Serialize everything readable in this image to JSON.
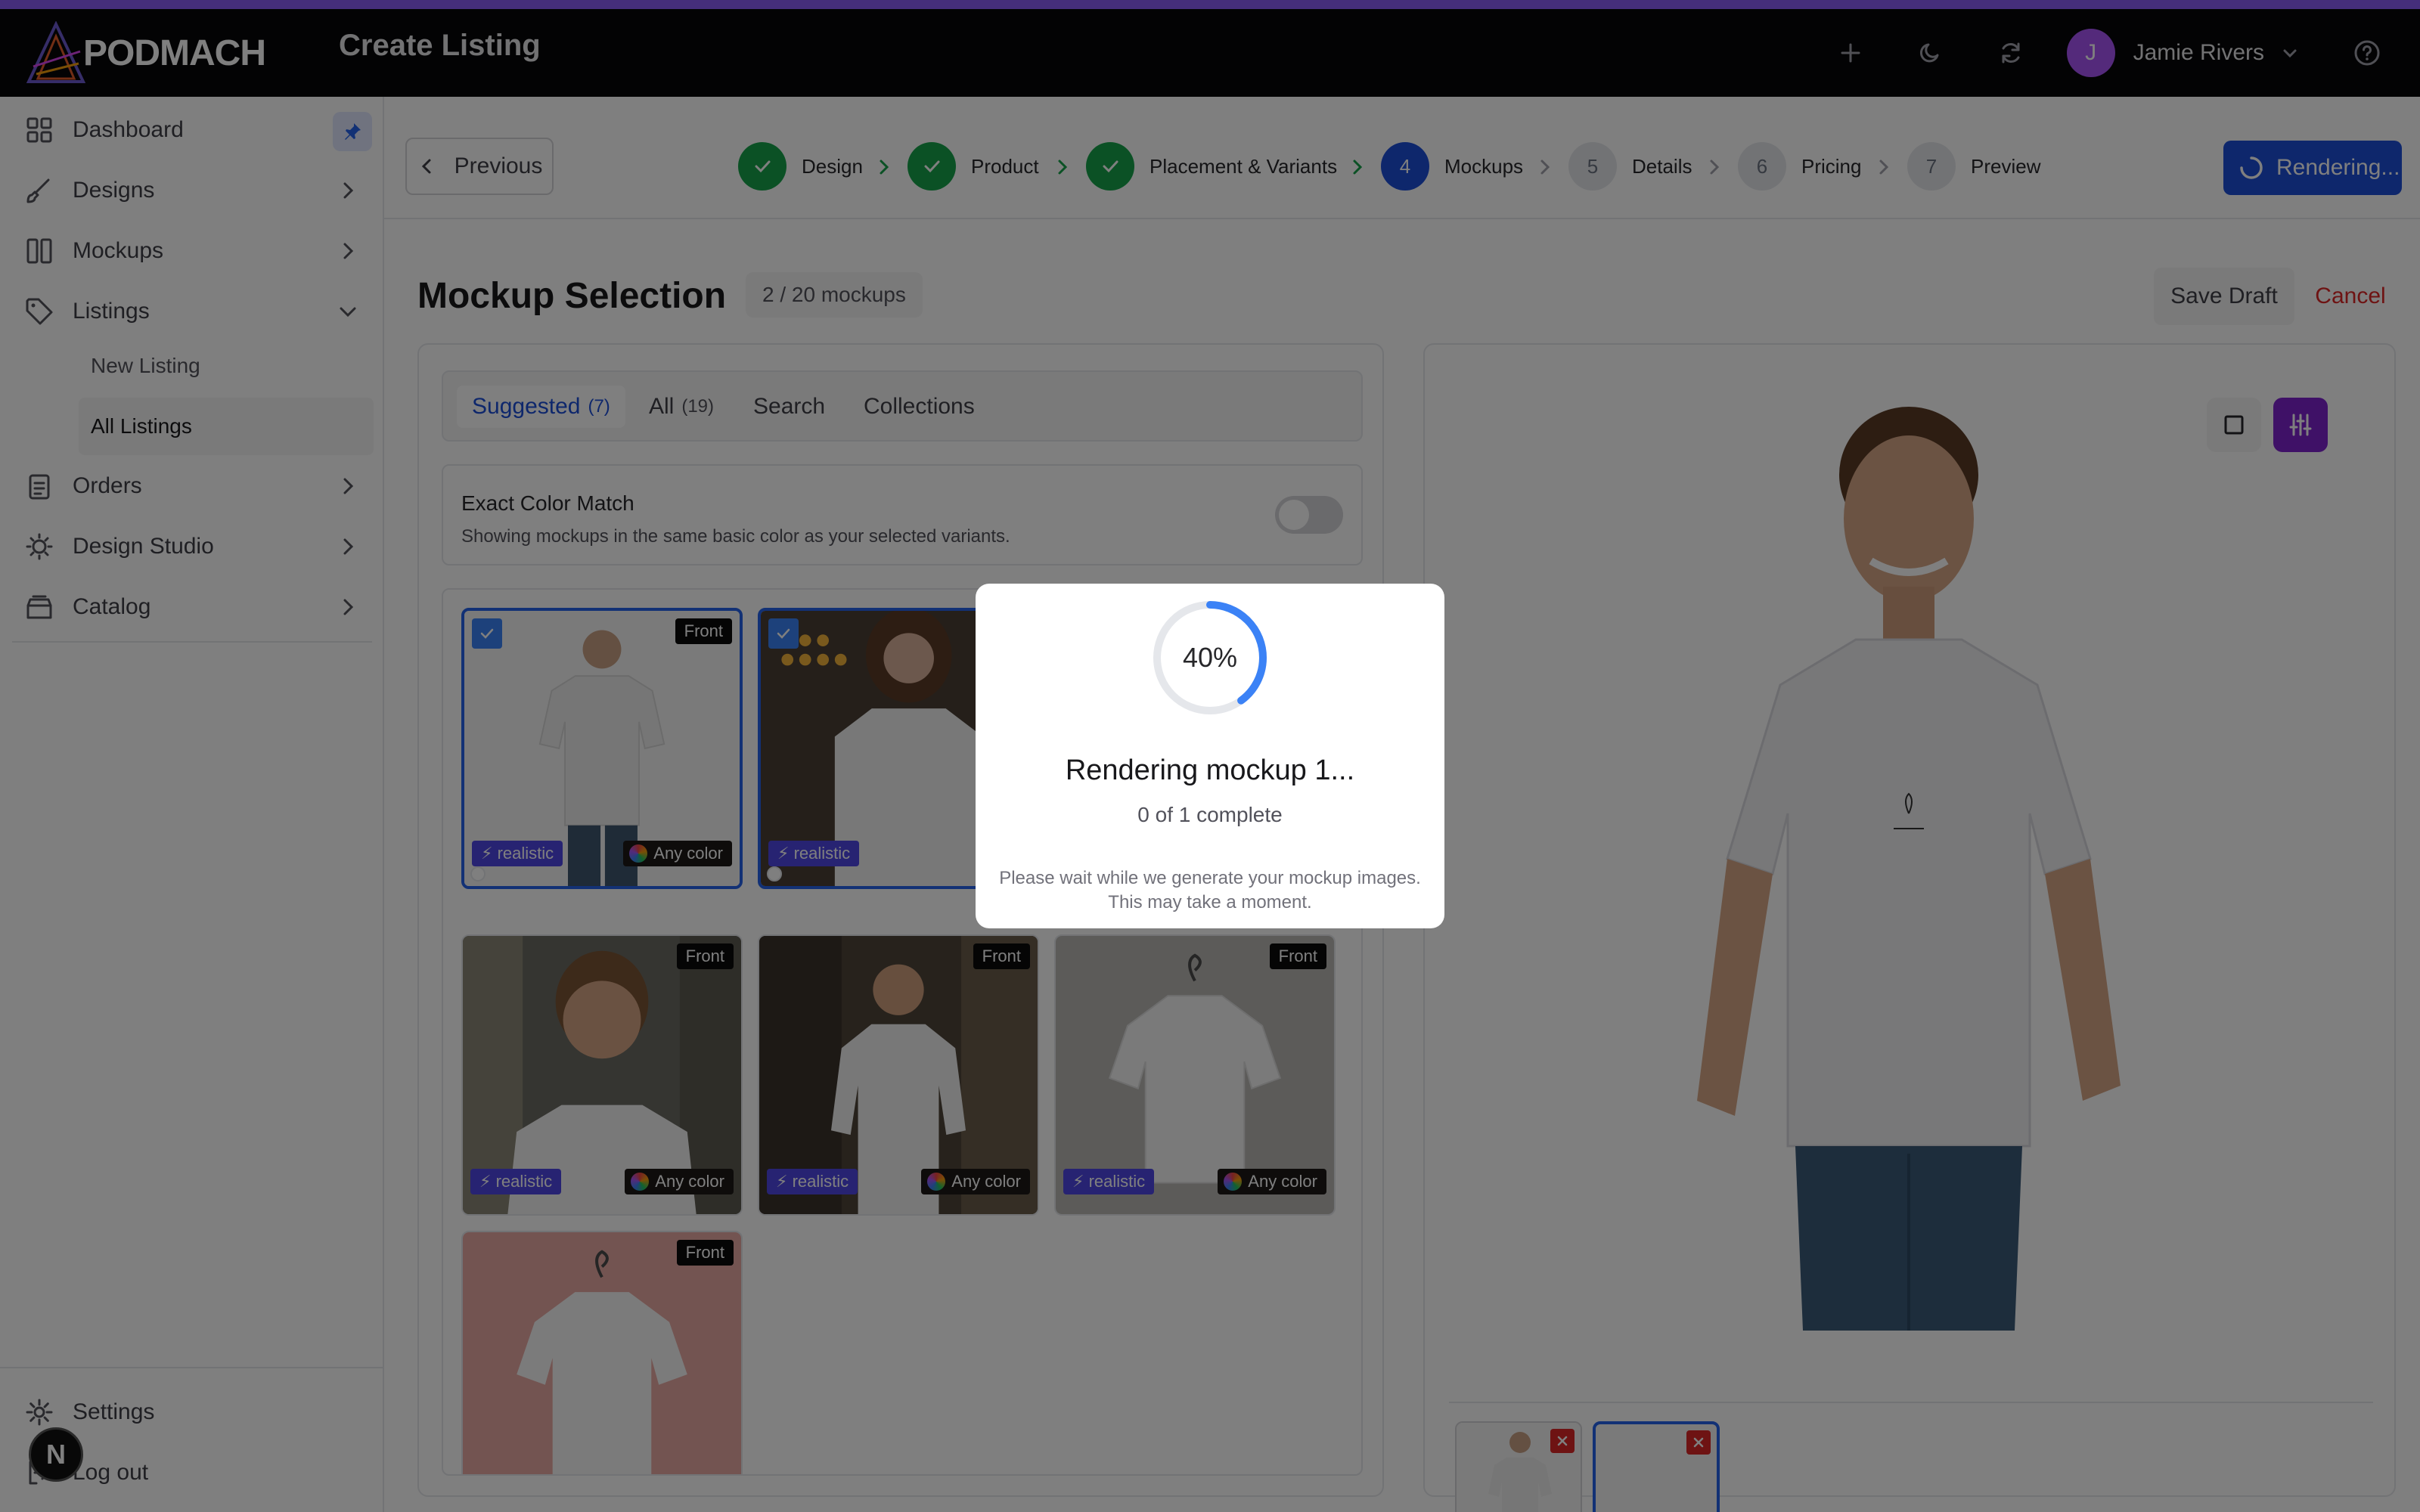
{
  "app": {
    "brand": "PODMACH",
    "page_title": "Create Listing",
    "user_name": "Jamie Rivers",
    "user_initial": "J",
    "accent_color": "#8b5cf6"
  },
  "sidebar": {
    "items": [
      {
        "label": "Dashboard",
        "icon": "grid-icon"
      },
      {
        "label": "Designs",
        "icon": "brush-icon"
      },
      {
        "label": "Mockups",
        "icon": "columns-icon"
      },
      {
        "label": "Listings",
        "icon": "tag-icon"
      },
      {
        "label": "Orders",
        "icon": "clipboard-icon"
      },
      {
        "label": "Design Studio",
        "icon": "lightbulb-icon"
      },
      {
        "label": "Catalog",
        "icon": "archive-icon"
      }
    ],
    "sub_items": [
      "New Listing",
      "All Listings"
    ],
    "settings_label": "Settings",
    "logout_label": "Log out",
    "badge_letter": "N"
  },
  "stepper": {
    "previous_label": "Previous",
    "steps": [
      {
        "num": "1",
        "label": "Design",
        "state": "done"
      },
      {
        "num": "2",
        "label": "Product",
        "state": "done"
      },
      {
        "num": "3",
        "label": "Placement & Variants",
        "state": "done"
      },
      {
        "num": "4",
        "label": "Mockups",
        "state": "current"
      },
      {
        "num": "5",
        "label": "Details",
        "state": "todo"
      },
      {
        "num": "6",
        "label": "Pricing",
        "state": "todo"
      },
      {
        "num": "7",
        "label": "Preview",
        "state": "todo"
      }
    ],
    "render_label": "Rendering..."
  },
  "selection": {
    "title": "Mockup Selection",
    "count": "2 / 20 mockups",
    "save_draft": "Save Draft",
    "cancel": "Cancel"
  },
  "tabs": [
    {
      "label": "Suggested",
      "count": "(7)"
    },
    {
      "label": "All",
      "count": "(19)"
    },
    {
      "label": "Search",
      "count": ""
    },
    {
      "label": "Collections",
      "count": ""
    }
  ],
  "color_match": {
    "title": "Exact Color Match",
    "description": "Showing mockups in the same basic color as your selected variants."
  },
  "card_tags": {
    "front": "Front",
    "realistic": "realistic",
    "any_color": "Any color",
    "any_color_partial": "An"
  },
  "modal": {
    "progress": 0.4,
    "percent_label": "40%",
    "title": "Rendering mockup 1...",
    "subtitle": "0 of 1 complete",
    "note_line1": "Please wait while we generate your mockup images.",
    "note_line2": "This may take a moment."
  }
}
